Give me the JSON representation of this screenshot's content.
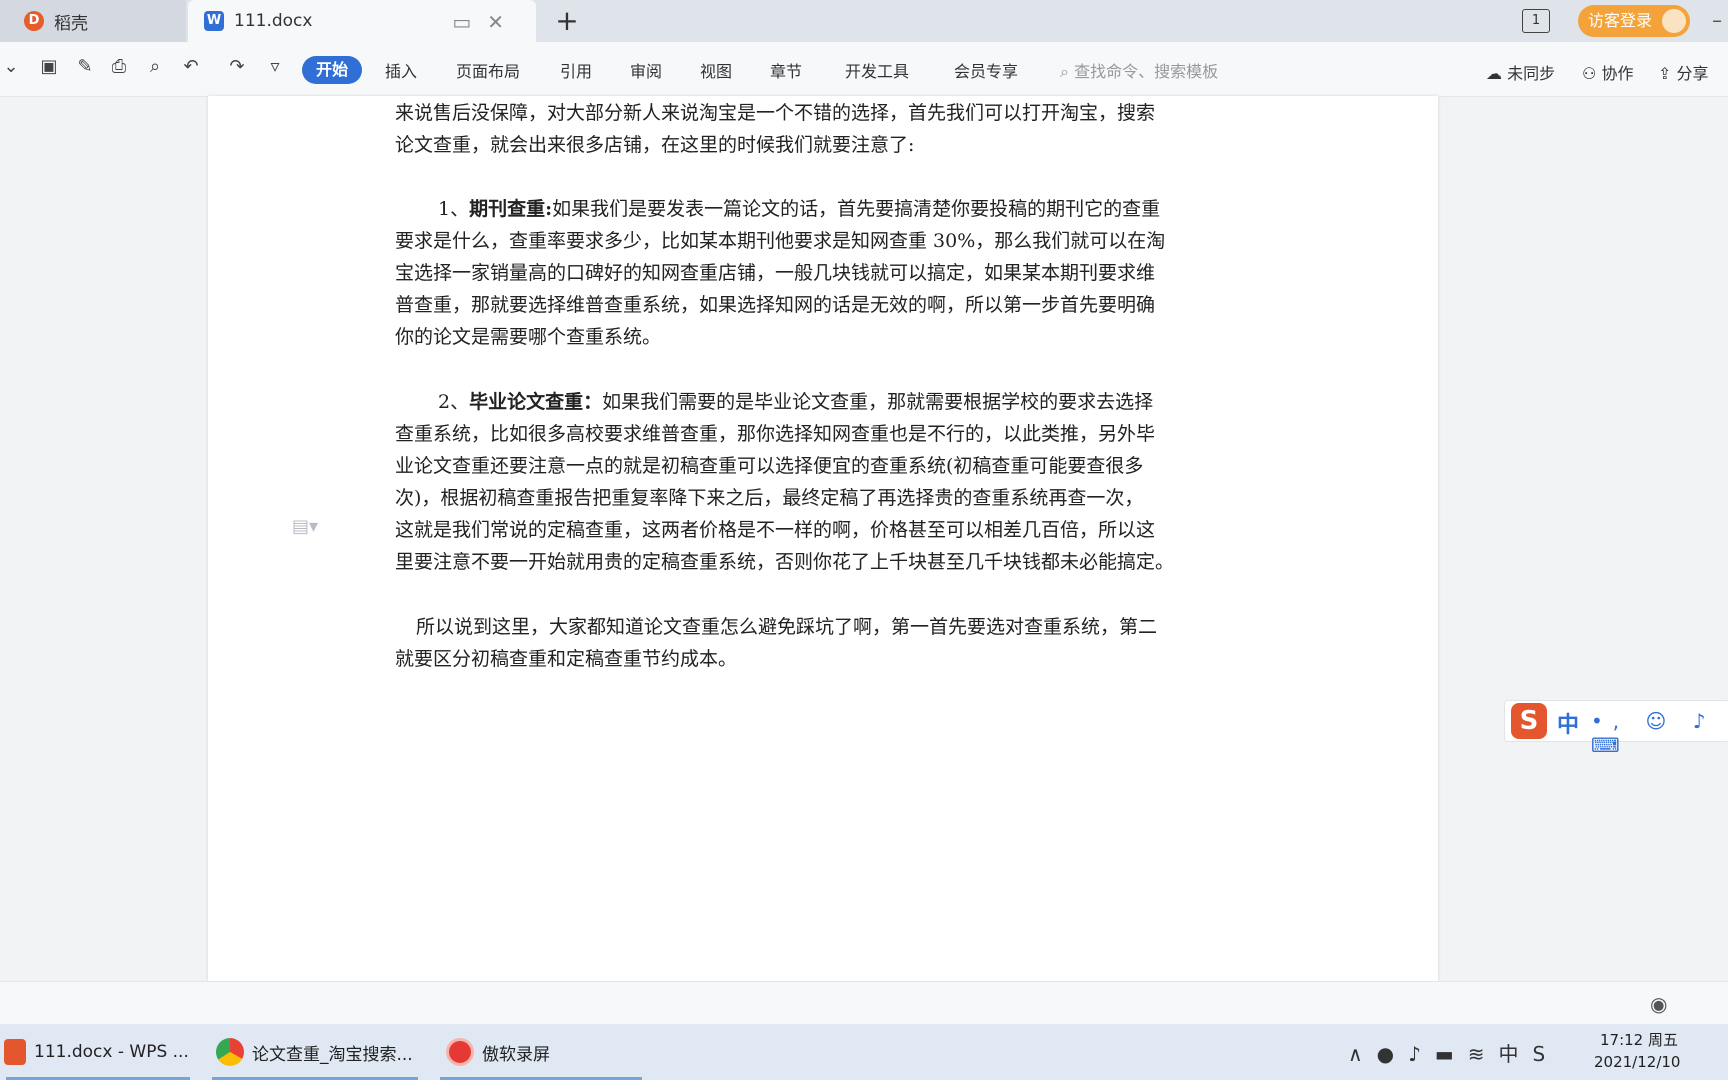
{
  "tabs": [
    {
      "label": "稻壳"
    },
    {
      "label": "111.docx"
    }
  ],
  "new_tab": "+",
  "tab_count": "1",
  "login_label": "访客登录",
  "menu": [
    "开始",
    "插入",
    "页面布局",
    "引用",
    "审阅",
    "视图",
    "章节",
    "开发工具",
    "会员专享"
  ],
  "search_placeholder": "查找命令、搜索模板",
  "right_actions": [
    "未同步",
    "协作",
    "分享"
  ],
  "doc": {
    "lines": [
      "来说售后没保障，对大部分新人来说淘宝是一个不错的选择，首先我们可以打开淘宝，搜索",
      "论文查重，就会出来很多店铺，在这里的时候我们就要注意了:",
      "",
      "如果我们是要发表一篇论文的话，首先要搞清楚你要投稿的期刊它的查重",
      "要求是什么，查重率要求多少，比如某本期刊他要求是知网查重 30%，那么我们就可以在淘",
      "宝选择一家销量高的口碑好的知网查重店铺，一般几块钱就可以搞定，如果某本期刊要求维",
      "普查重，那就要选择维普查重系统，如果选择知网的话是无效的啊，所以第一步首先要明确",
      "你的论文是需要哪个查重系统。",
      "",
      "如果我们需要的是毕业论文查重，那就需要根据学校的要求去选择",
      "查重系统，比如很多高校要求维普查重，那你选择知网查重也是不行的，以此类推，另外毕",
      "业论文查重还要注意一点的就是初稿查重可以选择便宜的查重系统(初稿查重可能要查很多",
      "次)，根据初稿查重报告把重复率降下来之后，最终定稿了再选择贵的查重系统再查一次，",
      "这就是我们常说的定稿查重，这两者价格是不一样的啊，价格甚至可以相差几百倍，所以这",
      "里要注意不要一开始就用贵的定稿查重系统，否则你花了上千块甚至几千块钱都未必能搞定。",
      "",
      "所以说到这里，大家都知道论文查重怎么避免踩坑了啊，第一首先要选对查重系统，第二",
      "就要区分初稿查重和定稿查重节约成本。"
    ],
    "p1_prefix": "1、",
    "p1_bold": "期刊查重:",
    "p2_prefix": "2、",
    "p2_bold": "毕业论文查重："
  },
  "ime": {
    "logo": "S",
    "mode": "中",
    "ops": "•, ☺ ♪ ⌨"
  },
  "taskbar": [
    {
      "label": "111.docx - WPS ..."
    },
    {
      "label": "论文查重_淘宝搜索..."
    },
    {
      "label": "傲软录屏"
    }
  ],
  "tray_ime": "中",
  "clock": {
    "time": "17:12 周五",
    "date": "2021/12/10"
  }
}
